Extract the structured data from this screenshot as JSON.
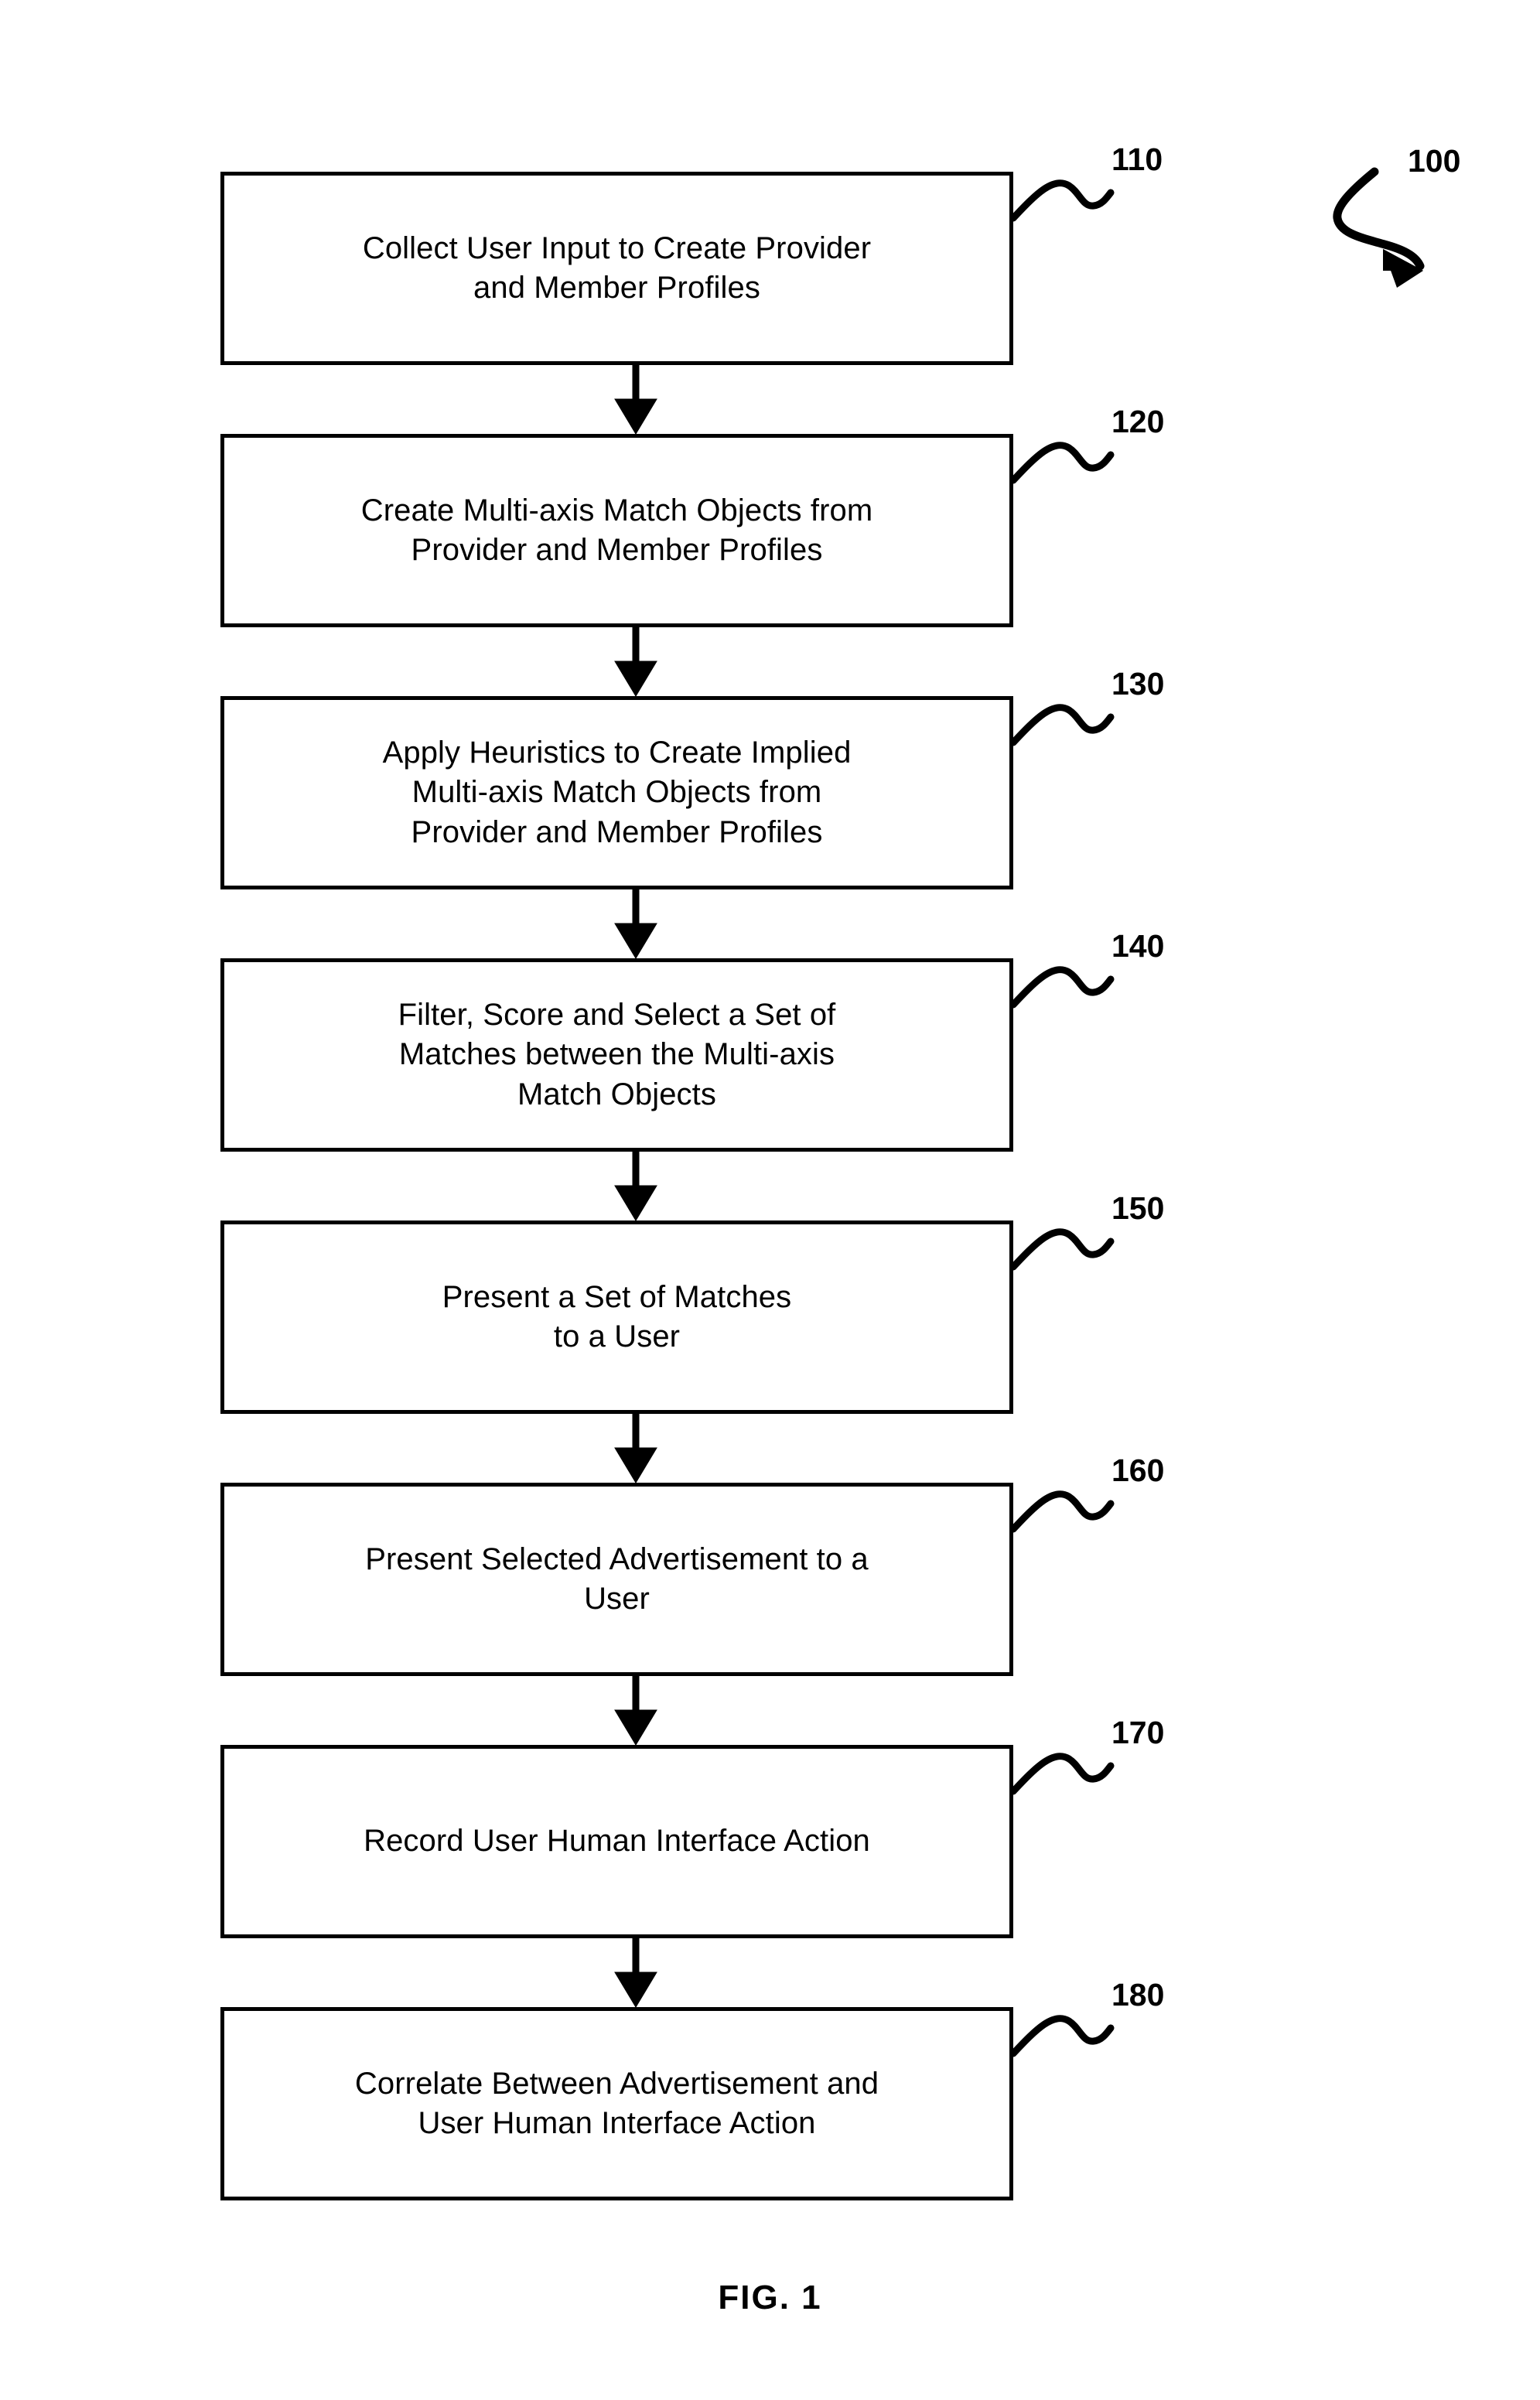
{
  "figure": {
    "caption": "FIG. 1",
    "overall_reference": "100"
  },
  "steps": [
    {
      "ref": "110",
      "label": "Collect User Input to Create Provider\nand Member Profiles"
    },
    {
      "ref": "120",
      "label": "Create Multi-axis Match Objects from\nProvider and Member Profiles"
    },
    {
      "ref": "130",
      "label": "Apply Heuristics to Create Implied\nMulti-axis Match Objects from\nProvider and Member Profiles"
    },
    {
      "ref": "140",
      "label": "Filter, Score and Select a Set of\nMatches between the Multi-axis\nMatch Objects"
    },
    {
      "ref": "150",
      "label": "Present a Set of Matches\nto a User"
    },
    {
      "ref": "160",
      "label": "Present Selected Advertisement to a\nUser"
    },
    {
      "ref": "170",
      "label": "Record User Human Interface Action"
    },
    {
      "ref": "180",
      "label": "Correlate Between Advertisement and\nUser Human Interface Action"
    }
  ],
  "style": {
    "line_color": "#000000",
    "background_color": "#ffffff"
  }
}
